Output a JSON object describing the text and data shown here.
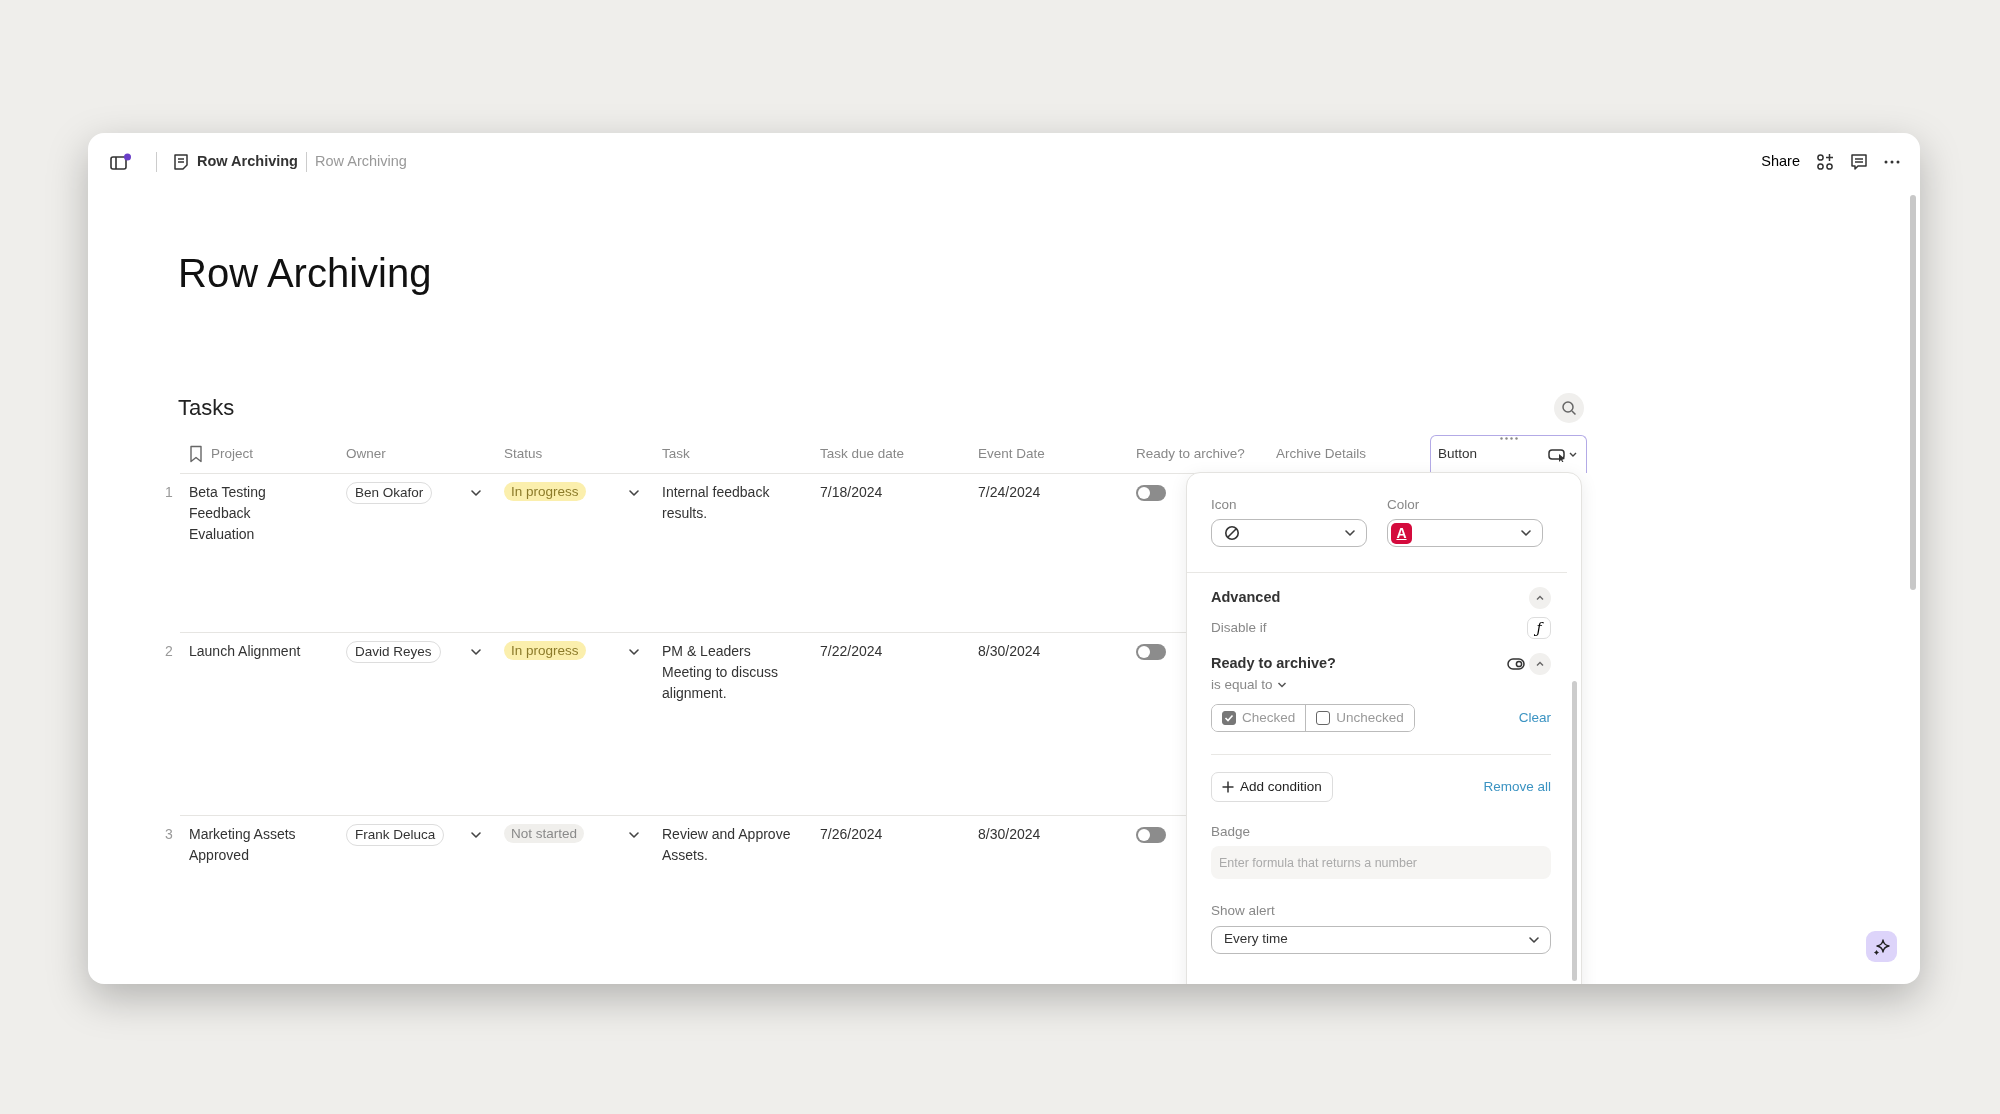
{
  "topbar": {
    "doc_title": "Row Archiving",
    "page_title": "Row Archiving",
    "share": "Share",
    "sidebar_notification": true
  },
  "page": {
    "title": "Row Archiving"
  },
  "table": {
    "title": "Tasks",
    "columns": [
      {
        "label": "Project",
        "selected": false
      },
      {
        "label": "Owner",
        "selected": false
      },
      {
        "label": "Status",
        "selected": false
      },
      {
        "label": "Task",
        "selected": false
      },
      {
        "label": "Task due date",
        "selected": false
      },
      {
        "label": "Event Date",
        "selected": false
      },
      {
        "label": "Ready to archive?",
        "selected": false
      },
      {
        "label": "Archive Details",
        "selected": false
      },
      {
        "label": "Button",
        "selected": true
      }
    ],
    "rows": [
      {
        "number": "1",
        "project": "Beta Testing Feedback Evaluation",
        "owner": "Ben Okafor",
        "status": {
          "label": "In progress",
          "kind": "in_progress"
        },
        "task": "Internal feedback results.",
        "due": "7/18/2024",
        "event": "7/24/2024",
        "ready": false
      },
      {
        "number": "2",
        "project": "Launch Alignment",
        "owner": "David Reyes",
        "status": {
          "label": "In progress",
          "kind": "in_progress"
        },
        "task": "PM & Leaders Meeting to discuss alignment.",
        "due": "7/22/2024",
        "event": "8/30/2024",
        "ready": false
      },
      {
        "number": "3",
        "project": "Marketing Assets Approved",
        "owner": "Frank Deluca",
        "status": {
          "label": "Not started",
          "kind": "not_started"
        },
        "task": "Review and Approve Assets.",
        "due": "7/26/2024",
        "event": "8/30/2024",
        "ready": false
      }
    ]
  },
  "panel": {
    "icon": {
      "label": "Icon"
    },
    "color": {
      "label": "Color",
      "color": "#d40b3d",
      "letter": "A"
    },
    "advanced": {
      "title": "Advanced",
      "expanded": true
    },
    "disable_if": {
      "label": "Disable if",
      "button": "ƒ"
    },
    "condition": {
      "field": "Ready to archive?",
      "operator": "is equal to",
      "expanded": true,
      "options": [
        {
          "label": "Checked",
          "selected": true
        },
        {
          "label": "Unchecked",
          "selected": false
        }
      ],
      "clear": "Clear"
    },
    "add_condition": "Add condition",
    "remove_all": "Remove all",
    "badge": {
      "label": "Badge",
      "placeholder": "Enter formula that returns a number"
    },
    "alert": {
      "label": "Show alert",
      "value": "Every time"
    }
  }
}
